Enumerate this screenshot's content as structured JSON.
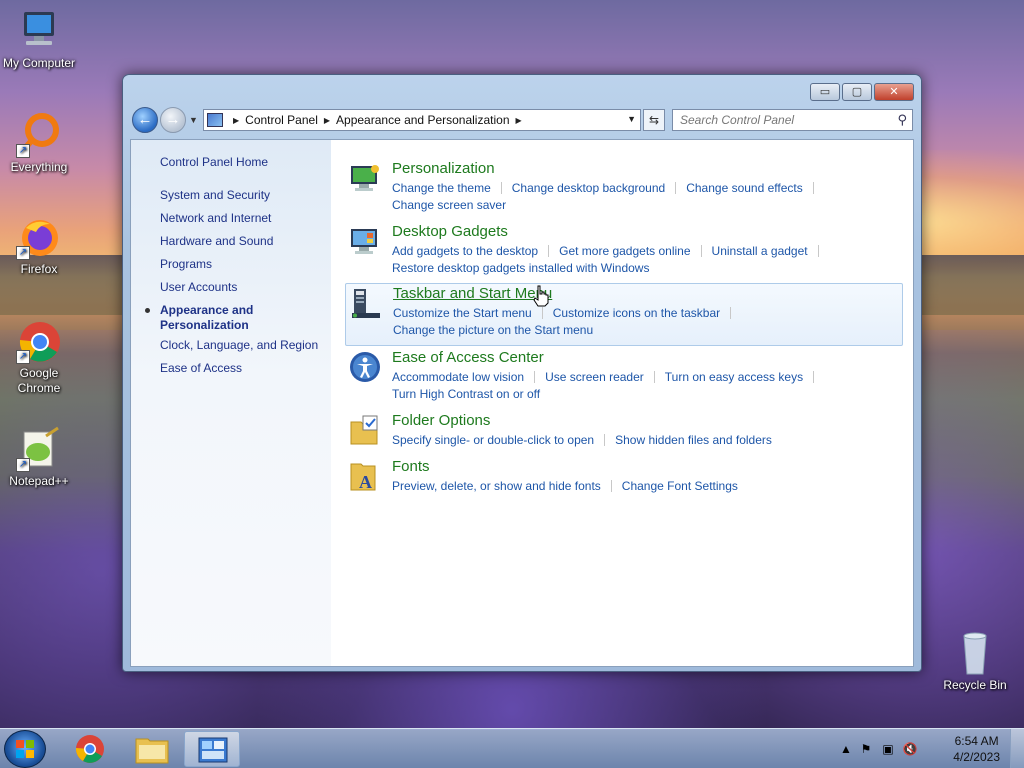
{
  "desktop": {
    "icons": [
      {
        "label": "My Computer"
      },
      {
        "label": "Everything"
      },
      {
        "label": "Firefox"
      },
      {
        "label": "Google Chrome"
      },
      {
        "label": "Notepad++"
      },
      {
        "label": "Recycle Bin"
      }
    ]
  },
  "window": {
    "controls": {
      "minimize": "▭",
      "maximize": "▢",
      "close": "✕"
    },
    "address": {
      "crumbs": [
        "Control Panel",
        "Appearance and Personalization"
      ]
    },
    "search": {
      "placeholder": "Search Control Panel"
    },
    "sidebar": {
      "home": "Control Panel Home",
      "items": [
        "System and Security",
        "Network and Internet",
        "Hardware and Sound",
        "Programs",
        "User Accounts",
        "Appearance and Personalization",
        "Clock, Language, and Region",
        "Ease of Access"
      ],
      "current_index": 5
    },
    "categories": [
      {
        "title": "Personalization",
        "icon": "personalization-icon",
        "links": [
          "Change the theme",
          "Change desktop background",
          "Change sound effects",
          "Change screen saver"
        ]
      },
      {
        "title": "Desktop Gadgets",
        "icon": "gadgets-icon",
        "links": [
          "Add gadgets to the desktop",
          "Get more gadgets online",
          "Uninstall a gadget",
          "Restore desktop gadgets installed with Windows"
        ]
      },
      {
        "title": "Taskbar and Start Menu",
        "icon": "taskbar-icon",
        "links": [
          "Customize the Start menu",
          "Customize icons on the taskbar",
          "Change the picture on the Start menu"
        ]
      },
      {
        "title": "Ease of Access Center",
        "icon": "ease-of-access-icon",
        "links": [
          "Accommodate low vision",
          "Use screen reader",
          "Turn on easy access keys",
          "Turn High Contrast on or off"
        ]
      },
      {
        "title": "Folder Options",
        "icon": "folder-options-icon",
        "links": [
          "Specify single- or double-click to open",
          "Show hidden files and folders"
        ]
      },
      {
        "title": "Fonts",
        "icon": "fonts-icon",
        "links": [
          "Preview, delete, or show and hide fonts",
          "Change Font Settings"
        ]
      }
    ]
  },
  "taskbar": {
    "clock": {
      "time": "6:54 AM",
      "date": "4/2/2023"
    },
    "tray_icons": [
      "show-hidden-icons-arrow",
      "action-center-icon",
      "network-icon",
      "volume-muted-icon"
    ]
  },
  "colors": {
    "category_title": "#1e7a1e",
    "link": "#1e56a8",
    "nav_link": "#1e3287"
  }
}
